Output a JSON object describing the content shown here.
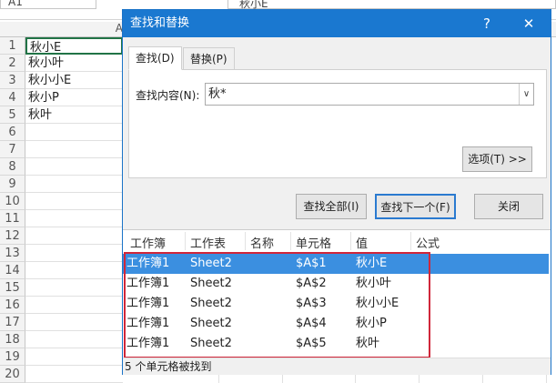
{
  "formula_bar": {
    "name_box": "A1",
    "formula": "秋小E"
  },
  "sheet": {
    "column_header": "A",
    "rows": [
      "1",
      "2",
      "3",
      "4",
      "5",
      "6",
      "7",
      "8",
      "9",
      "10",
      "11",
      "12",
      "13",
      "14",
      "15",
      "16",
      "17",
      "18",
      "19",
      "20"
    ],
    "cells": [
      "秋小E",
      "秋小叶",
      "秋小小E",
      "秋小P",
      "秋叶"
    ]
  },
  "dialog": {
    "title": "查找和替换",
    "help": "?",
    "close": "✕",
    "tabs": [
      "查找(D)",
      "替换(P)"
    ],
    "find_label": "查找内容(N):",
    "find_value": "秋*",
    "options_button": "选项(T) >>",
    "find_all": "查找全部(I)",
    "find_next": "查找下一个(F)",
    "close_button": "关闭",
    "columns": [
      "工作簿",
      "工作表",
      "名称",
      "单元格",
      "值",
      "公式"
    ],
    "results": [
      {
        "book": "工作簿1",
        "sheet": "Sheet2",
        "name": "",
        "cell": "$A$1",
        "value": "秋小E",
        "formula": ""
      },
      {
        "book": "工作簿1",
        "sheet": "Sheet2",
        "name": "",
        "cell": "$A$2",
        "value": "秋小叶",
        "formula": ""
      },
      {
        "book": "工作簿1",
        "sheet": "Sheet2",
        "name": "",
        "cell": "$A$3",
        "value": "秋小小E",
        "formula": ""
      },
      {
        "book": "工作簿1",
        "sheet": "Sheet2",
        "name": "",
        "cell": "$A$4",
        "value": "秋小P",
        "formula": ""
      },
      {
        "book": "工作簿1",
        "sheet": "Sheet2",
        "name": "",
        "cell": "$A$5",
        "value": "秋叶",
        "formula": ""
      }
    ],
    "status": "5 个单元格被找到"
  }
}
